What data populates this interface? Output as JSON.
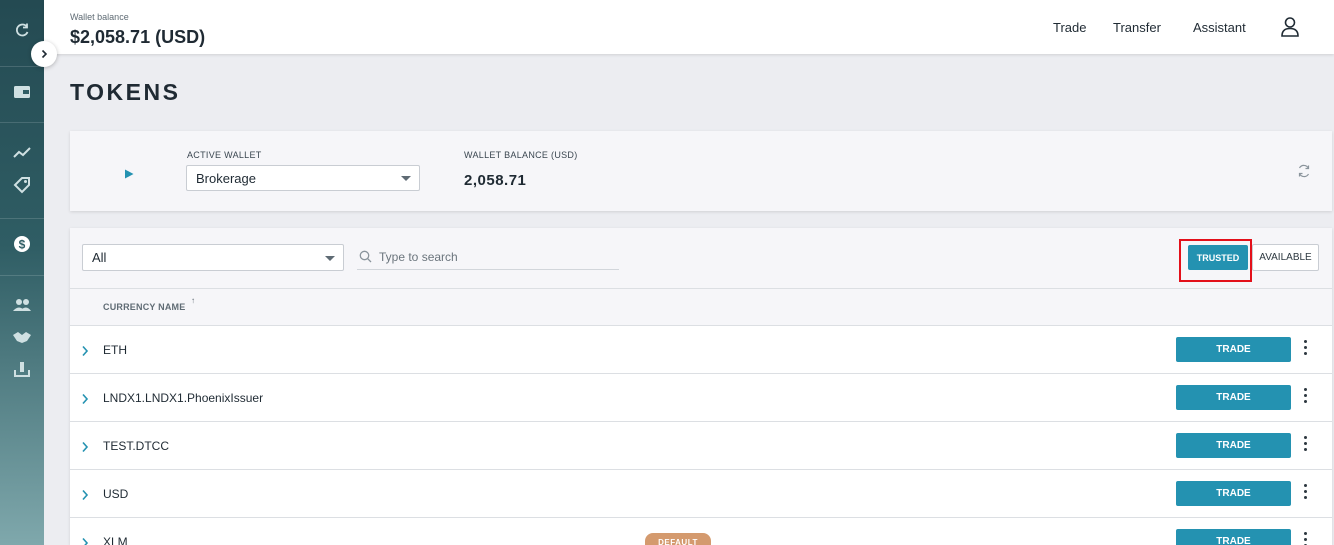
{
  "header": {
    "wallet_balance_label": "Wallet balance",
    "wallet_balance_value": "$2,058.71 (USD)",
    "nav": [
      "Trade",
      "Transfer",
      "Assistant"
    ]
  },
  "page_title": "TOKENS",
  "wallet_card": {
    "active_wallet_label": "ACTIVE WALLET",
    "active_wallet_value": "Brokerage",
    "balance_label": "WALLET BALANCE (USD)",
    "balance_value": "2,058.71"
  },
  "tokens": {
    "filter_value": "All",
    "search_placeholder": "Type to search",
    "trusted_label": "TRUSTED",
    "available_label": "AVAILABLE",
    "column_header": "CURRENCY NAME",
    "sort_glyph": "↑",
    "trade_label": "TRADE",
    "default_label": "DEFAULT",
    "rows": [
      "ETH",
      "LNDX1.LNDX1.PhoenixIssuer",
      "TEST.DTCC",
      "USD",
      "XLM"
    ]
  },
  "colors": {
    "accent": "#2492b1",
    "highlight": "#e3101a",
    "badge": "#d49a6e",
    "sidebar": "#2f5d64"
  },
  "icons": {
    "sidebar": [
      "refresh-icon",
      "wallet-icon",
      "trend-icon",
      "tag-icon",
      "dollar-icon",
      "group-icon",
      "handshake-icon",
      "upload-icon"
    ],
    "header": "user-icon"
  }
}
